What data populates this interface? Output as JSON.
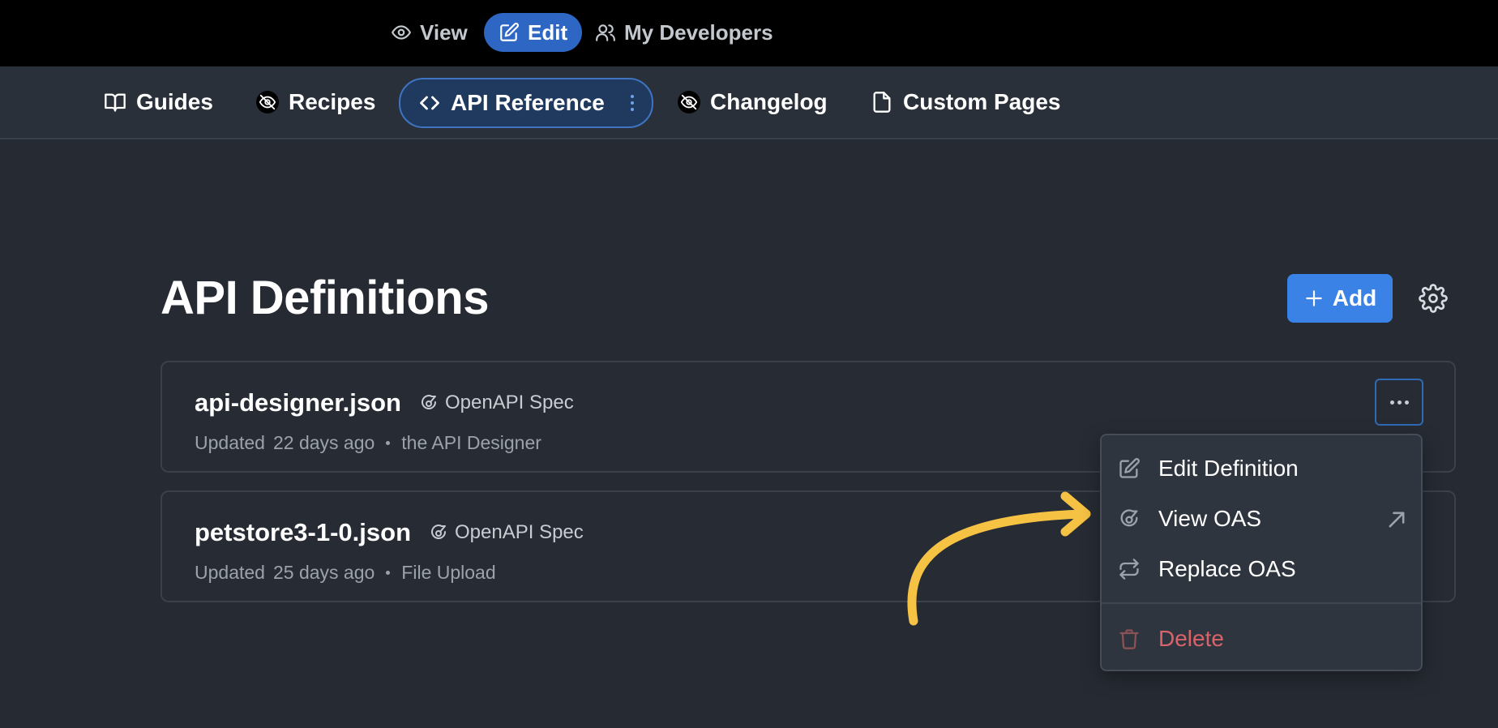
{
  "topbar": {
    "view_label": "View",
    "edit_label": "Edit",
    "developers_label": "My Developers"
  },
  "nav": {
    "guides": "Guides",
    "recipes": "Recipes",
    "api_reference": "API Reference",
    "changelog": "Changelog",
    "custom_pages": "Custom Pages"
  },
  "page": {
    "title": "API Definitions",
    "add_label": "Add"
  },
  "definitions": [
    {
      "name": "api-designer.json",
      "spec": "OpenAPI Spec",
      "updated_label": "Updated",
      "updated_ago": "22 days ago",
      "source": "the API Designer"
    },
    {
      "name": "petstore3-1-0.json",
      "spec": "OpenAPI Spec",
      "updated_label": "Updated",
      "updated_ago": "25 days ago",
      "source": "File Upload"
    }
  ],
  "menu": {
    "edit_definition": "Edit Definition",
    "view_oas": "View OAS",
    "replace_oas": "Replace OAS",
    "delete": "Delete"
  },
  "colors": {
    "accent": "#3b82e6",
    "active_edit": "#2e66c4",
    "danger": "#d8646a",
    "annotation": "#f6c244"
  },
  "icons": [
    "eye-icon",
    "edit-icon",
    "users-icon",
    "book-icon",
    "eye-off-icon",
    "code-icon",
    "file-icon",
    "plus-icon",
    "gear-icon",
    "openapi-icon",
    "more-icon",
    "external-link-icon",
    "swap-icon",
    "trash-icon"
  ]
}
